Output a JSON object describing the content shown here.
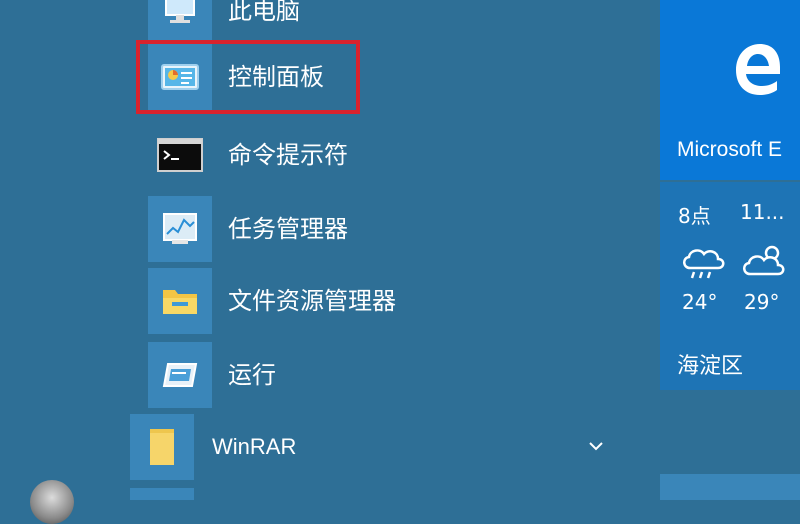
{
  "start_menu": {
    "items": [
      {
        "label": "此电脑",
        "icon": "computer-icon"
      },
      {
        "label": "控制面板",
        "icon": "control-panel-icon"
      },
      {
        "label": "命令提示符",
        "icon": "command-prompt-icon"
      },
      {
        "label": "任务管理器",
        "icon": "task-manager-icon"
      },
      {
        "label": "文件资源管理器",
        "icon": "file-explorer-icon"
      },
      {
        "label": "运行",
        "icon": "run-icon"
      }
    ],
    "group": {
      "label": "WinRAR",
      "icon": "folder-icon"
    }
  },
  "tiles": {
    "edge": {
      "label": "Microsoft E",
      "icon": "edge-icon"
    },
    "weather": {
      "forecast": [
        {
          "time": "8点",
          "temp": "24°",
          "icon": "rain-cloud-icon"
        },
        {
          "time": "11...",
          "temp": "29°",
          "icon": "cloudy-icon"
        }
      ],
      "city": "海淀区"
    }
  },
  "colors": {
    "background": "#2e6f96",
    "tile": "#3a86b9",
    "edge_tile": "#0a78d7",
    "weather_tile": "#1e74b5",
    "highlight_border": "#d9232d"
  }
}
